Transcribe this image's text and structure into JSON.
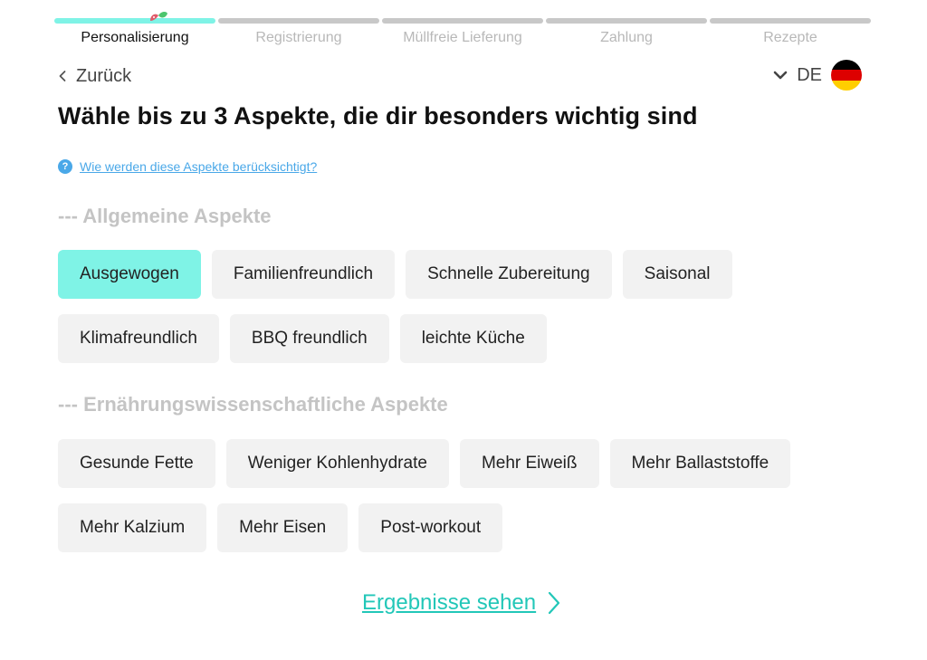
{
  "progress": {
    "steps": [
      {
        "label": "Personalisierung",
        "active": true
      },
      {
        "label": "Registrierung",
        "active": false
      },
      {
        "label": "Müllfreie Lieferung",
        "active": false
      },
      {
        "label": "Zahlung",
        "active": false
      },
      {
        "label": "Rezepte",
        "active": false
      }
    ]
  },
  "nav": {
    "back_label": "Zurück",
    "language_code": "DE"
  },
  "page": {
    "title": "Wähle bis zu 3 Aspekte, die dir besonders wichtig sind",
    "help_link": "Wie werden diese Aspekte berücksichtigt?"
  },
  "sections": [
    {
      "title": "--- Allgemeine Aspekte",
      "rows": [
        [
          {
            "label": "Ausgewogen",
            "selected": true
          },
          {
            "label": "Familienfreundlich",
            "selected": false
          },
          {
            "label": "Schnelle Zubereitung",
            "selected": false
          },
          {
            "label": "Saisonal",
            "selected": false
          }
        ],
        [
          {
            "label": "Klimafreundlich",
            "selected": false
          },
          {
            "label": "BBQ freundlich",
            "selected": false
          },
          {
            "label": "leichte Küche",
            "selected": false
          }
        ]
      ]
    },
    {
      "title": "--- Ernährungswissenschaftliche Aspekte",
      "rows": [
        [
          {
            "label": "Gesunde Fette",
            "selected": false
          },
          {
            "label": "Weniger Kohlenhydrate",
            "selected": false
          },
          {
            "label": "Mehr Eiweiß",
            "selected": false
          },
          {
            "label": "Mehr Ballaststoffe",
            "selected": false
          }
        ],
        [
          {
            "label": "Mehr Kalzium",
            "selected": false
          },
          {
            "label": "Mehr Eisen",
            "selected": false
          },
          {
            "label": "Post-workout",
            "selected": false
          }
        ]
      ]
    }
  ],
  "cta": {
    "label": "Ergebnisse sehen"
  },
  "colors": {
    "accent": "#7ff3e6",
    "cta": "#22c7b8",
    "link": "#4aa8e8",
    "flag": [
      "#000000",
      "#dd0000",
      "#ffce00"
    ]
  },
  "icons": {
    "back": "chevron-left-icon",
    "language": "chevron-down-icon",
    "help": "question-icon",
    "cta": "chevron-right-icon",
    "mascot": "mascot-icon"
  }
}
